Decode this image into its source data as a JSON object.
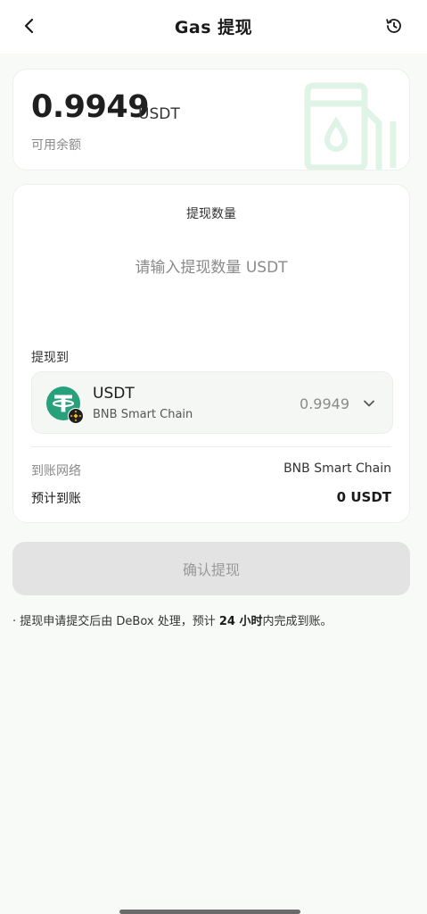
{
  "header": {
    "title": "Gas 提现",
    "back_icon": "chevron-left-icon",
    "history_icon": "history-clock-icon"
  },
  "balance": {
    "amount": "0.9949",
    "unit": "USDT",
    "label": "可用余额",
    "watermark_icon": "gas-pump-icon"
  },
  "withdraw": {
    "amount_title": "提现数量",
    "amount_placeholder": "请输入提现数量 USDT",
    "to_label": "提现到",
    "token": {
      "symbol": "USDT",
      "chain": "BNB Smart Chain",
      "balance": "0.9949",
      "logo_icon": "tether-icon",
      "chain_badge_icon": "bnb-chain-icon",
      "dropdown_icon": "chevron-down-icon"
    },
    "network_label": "到账网络",
    "network_value": "BNB Smart Chain",
    "eta_label": "预计到账",
    "eta_value": "0 USDT"
  },
  "confirm_button": "确认提现",
  "notice": {
    "bullet": "·",
    "prefix": "提现申请提交后由 DeBox 处理，预计 ",
    "highlight": "24 小时",
    "suffix": "内完成到账。"
  },
  "colors": {
    "accent_green": "#26a17b",
    "button_disabled_bg": "#e3e3e3",
    "watermark_green": "#dff3e6"
  }
}
